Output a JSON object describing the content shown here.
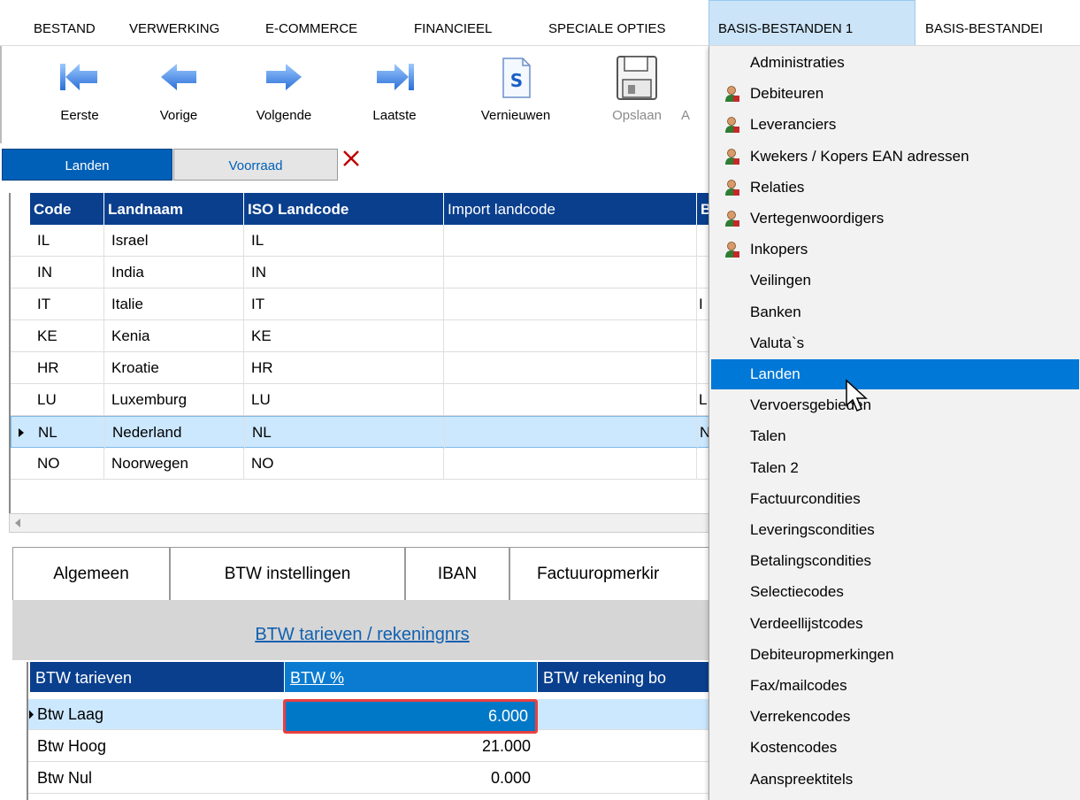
{
  "menubar": {
    "items": [
      "BESTAND",
      "VERWERKING",
      "E-COMMERCE",
      "FINANCIEEL",
      "SPECIALE OPTIES",
      "BASIS-BESTANDEN 1",
      "BASIS-BESTANDEI"
    ],
    "open_index": 5
  },
  "toolbar": {
    "first": "Eerste",
    "prev": "Vorige",
    "next": "Volgende",
    "last": "Laatste",
    "refresh": "Vernieuwen",
    "save": "Opslaan",
    "partial": "A"
  },
  "tabs": {
    "active": "Landen",
    "inactive": "Voorraad"
  },
  "grid": {
    "headers": [
      "Code",
      "Landnaam",
      "ISO Landcode",
      "Import landcode",
      "B"
    ],
    "rows": [
      {
        "code": "IL",
        "name": "Israel",
        "iso": "IL",
        "imp": "",
        "extra": ""
      },
      {
        "code": "IN",
        "name": "India",
        "iso": "IN",
        "imp": "",
        "extra": ""
      },
      {
        "code": "IT",
        "name": "Italie",
        "iso": "IT",
        "imp": "",
        "extra": "I"
      },
      {
        "code": "KE",
        "name": "Kenia",
        "iso": "KE",
        "imp": "",
        "extra": ""
      },
      {
        "code": "HR",
        "name": "Kroatie",
        "iso": "HR",
        "imp": "",
        "extra": ""
      },
      {
        "code": "LU",
        "name": "Luxemburg",
        "iso": "LU",
        "imp": "",
        "extra": "L"
      },
      {
        "code": "NL",
        "name": "Nederland",
        "iso": "NL",
        "imp": "",
        "extra": "N"
      },
      {
        "code": "NO",
        "name": "Noorwegen",
        "iso": "NO",
        "imp": "",
        "extra": ""
      }
    ],
    "selected_index": 6
  },
  "lower_tabs": [
    "Algemeen",
    "BTW instellingen",
    "IBAN",
    "Factuuropmerkir"
  ],
  "section_link": "BTW tarieven / rekeningnrs",
  "btw": {
    "headers": [
      "BTW tarieven",
      "BTW %",
      "BTW rekening bo"
    ],
    "rows": [
      {
        "name": "Btw Laag",
        "pct": "6.000"
      },
      {
        "name": "Btw Hoog",
        "pct": "21.000"
      },
      {
        "name": "Btw Nul",
        "pct": "0.000"
      }
    ]
  },
  "dropdown": {
    "items": [
      {
        "label": "Administraties",
        "icon": ""
      },
      {
        "label": "Debiteuren",
        "icon": "person-icon"
      },
      {
        "label": "Leveranciers",
        "icon": "person-icon"
      },
      {
        "label": "Kwekers / Kopers EAN adressen",
        "icon": "person-icon"
      },
      {
        "label": "Relaties",
        "icon": "person-icon"
      },
      {
        "label": "Vertegenwoordigers",
        "icon": "person-icon"
      },
      {
        "label": "Inkopers",
        "icon": "person-icon"
      },
      {
        "label": "Veilingen",
        "icon": ""
      },
      {
        "label": "Banken",
        "icon": ""
      },
      {
        "label": "Valuta`s",
        "icon": ""
      },
      {
        "label": "Landen",
        "icon": ""
      },
      {
        "label": "Vervoersgebieden",
        "icon": ""
      },
      {
        "label": "Talen",
        "icon": ""
      },
      {
        "label": "Talen 2",
        "icon": ""
      },
      {
        "label": "Factuurcondities",
        "icon": ""
      },
      {
        "label": "Leveringscondities",
        "icon": ""
      },
      {
        "label": "Betalingscondities",
        "icon": ""
      },
      {
        "label": "Selectiecodes",
        "icon": ""
      },
      {
        "label": "Verdeellijstcodes",
        "icon": ""
      },
      {
        "label": "Debiteuropmerkingen",
        "icon": ""
      },
      {
        "label": "Fax/mailcodes",
        "icon": ""
      },
      {
        "label": "Verrekencodes",
        "icon": ""
      },
      {
        "label": "Kostencodes",
        "icon": ""
      },
      {
        "label": "Aanspreektitels",
        "icon": ""
      }
    ],
    "highlighted_index": 10
  },
  "colors": {
    "accent": "#0078d7",
    "header": "#0a3f8e",
    "selection": "#cce8ff",
    "focus_border": "#e84040"
  }
}
